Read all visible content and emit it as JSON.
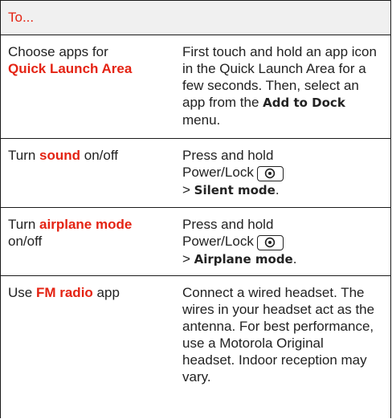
{
  "colors": {
    "accent": "#e42313",
    "header_bg": "#f0f0f0",
    "text": "#222222",
    "border": "#1a1a1a"
  },
  "header": {
    "title": "To..."
  },
  "rows": [
    {
      "left": {
        "text1": "Choose apps for",
        "accent": "Quick Launch Area"
      },
      "right": {
        "text1": "First touch and hold an app icon in the Quick Launch Area for a few seconds. Then, select an app from the ",
        "strong": "Add to Dock",
        "text2": " menu."
      }
    },
    {
      "left": {
        "pre": "Turn ",
        "accent": "sound",
        "post": " on/off"
      },
      "right": {
        "line1": "Press and hold",
        "line2": "Power/Lock",
        "icon": "power-icon",
        "pre": "> ",
        "strong": "Silent mode",
        "post": "."
      }
    },
    {
      "left": {
        "pre": "Turn ",
        "accent": "airplane mode",
        "post": "on/off"
      },
      "right": {
        "line1": "Press and hold",
        "line2": "Power/Lock",
        "icon": "power-icon",
        "pre": "> ",
        "strong": "Airplane mode",
        "post": "."
      }
    },
    {
      "left": {
        "pre": "Use ",
        "accent": "FM radio",
        "post": " app"
      },
      "right": {
        "text": "Connect a wired headset. The wires in your headset act as the antenna. For best performance, use a Motorola Original headset. Indoor reception may vary."
      }
    }
  ]
}
